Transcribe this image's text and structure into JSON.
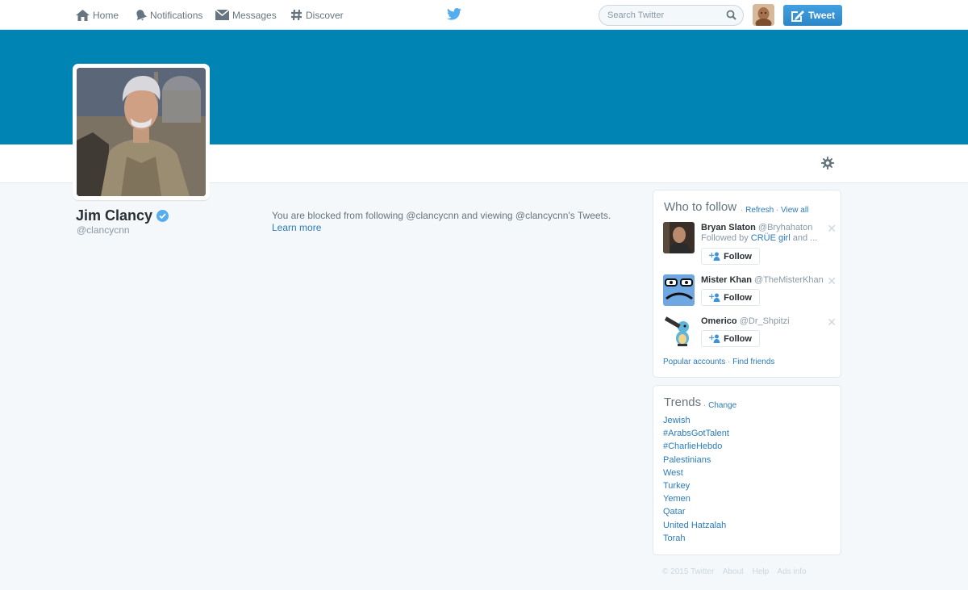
{
  "nav": {
    "home": "Home",
    "notifications": "Notifications",
    "messages": "Messages",
    "discover": "Discover",
    "search_placeholder": "Search Twitter",
    "tweet_button": "Tweet"
  },
  "colors": {
    "banner": "#0084b4",
    "link": "#2b7bb9",
    "tweet_button": "#3b94d9",
    "verified": "#55acee"
  },
  "icons": [
    "home-icon",
    "bell-icon",
    "envelope-icon",
    "hash-icon",
    "twitter-bird-icon",
    "search-icon",
    "compose-icon",
    "gear-icon",
    "verified-badge-icon",
    "follow-user-icon",
    "close-icon"
  ],
  "profile": {
    "name": "Jim Clancy",
    "handle": "@clancycnn",
    "verified": true
  },
  "blocked_message": {
    "text": "You are blocked from following @clancycnn and viewing @clancycnn's Tweets. ",
    "learn_more": "Learn more"
  },
  "who_to_follow": {
    "title": "Who to follow",
    "refresh": "Refresh",
    "view_all": "View all",
    "suggestions": [
      {
        "name": "Bryan Slaton",
        "handle": "@Bryhahaton",
        "followed_by_prefix": "Followed by ",
        "followed_by_link": "CRÜE girl",
        "followed_by_suffix": " and ...",
        "follow_label": "Follow"
      },
      {
        "name": "Mister Khan",
        "handle": "@TheMisterKhan",
        "follow_label": "Follow"
      },
      {
        "name": "Omerico",
        "handle": "@Dr_Shpitzi",
        "follow_label": "Follow"
      }
    ],
    "popular_accounts": "Popular accounts",
    "find_friends": "Find friends"
  },
  "trends": {
    "title": "Trends",
    "change": "Change",
    "items": [
      "Jewish",
      "#ArabsGotTalent",
      "#CharlieHebdo",
      "Palestinians",
      "West",
      "Turkey",
      "Yemen",
      "Qatar",
      "United Hatzalah",
      "Torah"
    ]
  },
  "footer": {
    "copyright": "© 2015 Twitter",
    "about": "About",
    "help": "Help",
    "ads_info": "Ads info"
  }
}
